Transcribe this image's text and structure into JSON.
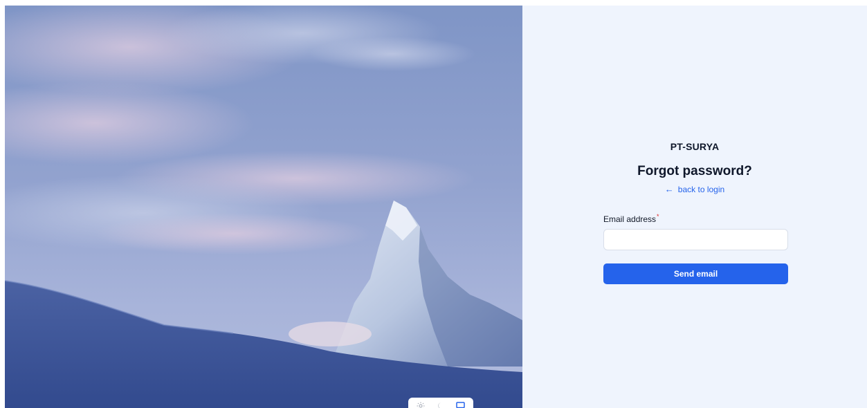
{
  "brand": "PT-SURYA",
  "title": "Forgot password?",
  "back_link": {
    "arrow": "←",
    "label": "back to login"
  },
  "form": {
    "email_label": "Email address",
    "required_mark": "*",
    "email_value": "",
    "email_placeholder": "",
    "submit_label": "Send email"
  },
  "theme_switcher": {
    "options": [
      "light-mode",
      "dark-mode",
      "system-mode"
    ],
    "selected": "system-mode"
  },
  "colors": {
    "accent": "#2563eb",
    "panel_bg": "#eff4fd",
    "required": "#dc2626"
  },
  "icons": {
    "light": "sun-icon",
    "dark": "moon-icon",
    "system": "monitor-icon"
  }
}
